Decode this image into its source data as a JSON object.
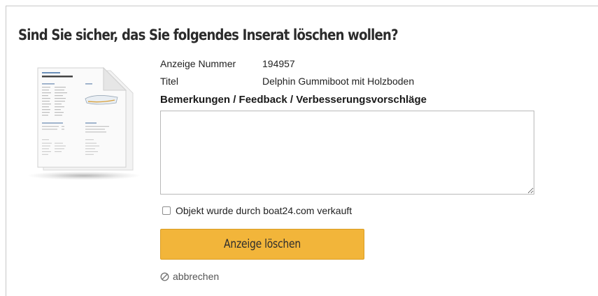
{
  "dialog": {
    "title": "Sind Sie sicher, das Sie folgendes Inserat löschen wollen?"
  },
  "listing": {
    "number_label": "Anzeige Nummer",
    "number_value": "194957",
    "title_label": "Titel",
    "title_value": "Delphin Gummiboot mit Holzboden"
  },
  "feedback": {
    "label": "Bemerkungen / Feedback / Verbesserungsvorschläge",
    "value": ""
  },
  "sold_checkbox": {
    "label": "Objekt wurde durch boat24.com verkauft",
    "checked": false
  },
  "actions": {
    "delete_label": "Anzeige löschen",
    "cancel_label": "abbrechen",
    "delete_color": "#f2b53a"
  },
  "icons": {
    "document": "document-preview-icon",
    "cancel": "cancel-circle-icon"
  }
}
